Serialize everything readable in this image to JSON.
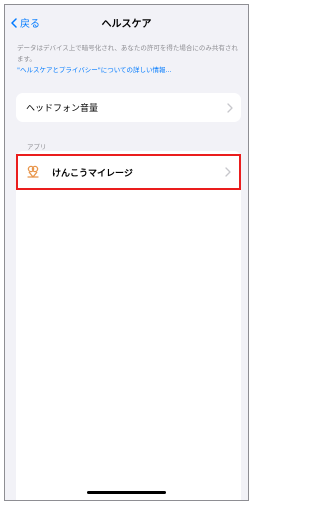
{
  "nav": {
    "back_label": "戻る",
    "title": "ヘルスケア"
  },
  "notice": {
    "text": "データはデバイス上で暗号化され、あなたの許可を得た場合にのみ共有されます。",
    "link": "\"ヘルスケアとプライバシー\"についての詳しい情報..."
  },
  "settings": {
    "headphone_label": "ヘッドフォン音量"
  },
  "apps": {
    "section_label": "アプリ",
    "items": [
      {
        "label": "けんこうマイレージ",
        "icon": "kenko-mileage-app-icon"
      }
    ]
  },
  "colors": {
    "accent": "#007aff",
    "highlight": "#ea1d1d",
    "background": "#f2f2f7",
    "app_icon": "#e8954a"
  }
}
